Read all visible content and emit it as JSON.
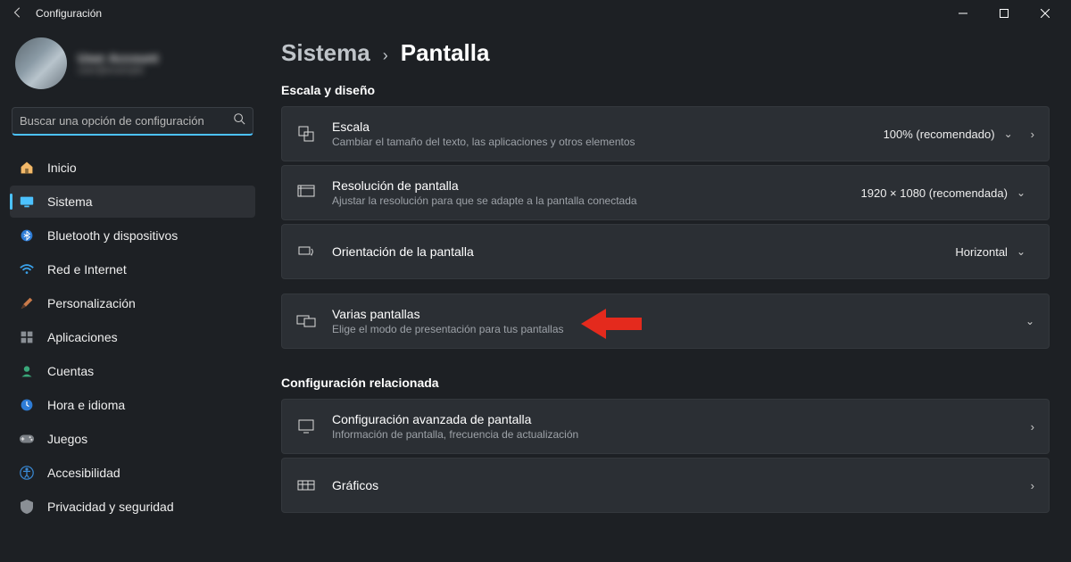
{
  "window": {
    "title": "Configuración"
  },
  "profile": {
    "name": "User Account",
    "sub": "user@example"
  },
  "search": {
    "placeholder": "Buscar una opción de configuración"
  },
  "sidebar": {
    "items": [
      {
        "label": "Inicio"
      },
      {
        "label": "Sistema"
      },
      {
        "label": "Bluetooth y dispositivos"
      },
      {
        "label": "Red e Internet"
      },
      {
        "label": "Personalización"
      },
      {
        "label": "Aplicaciones"
      },
      {
        "label": "Cuentas"
      },
      {
        "label": "Hora e idioma"
      },
      {
        "label": "Juegos"
      },
      {
        "label": "Accesibilidad"
      },
      {
        "label": "Privacidad y seguridad"
      }
    ]
  },
  "breadcrumb": {
    "parent": "Sistema",
    "current": "Pantalla"
  },
  "sections": {
    "scale_header": "Escala y diseño",
    "related_header": "Configuración relacionada"
  },
  "cards": {
    "scale": {
      "title": "Escala",
      "sub": "Cambiar el tamaño del texto, las aplicaciones y otros elementos",
      "value": "100% (recomendado)"
    },
    "resolution": {
      "title": "Resolución de pantalla",
      "sub": "Ajustar la resolución para que se adapte a la pantalla conectada",
      "value": "1920 × 1080 (recomendada)"
    },
    "orientation": {
      "title": "Orientación de la pantalla",
      "value": "Horizontal"
    },
    "multi": {
      "title": "Varias pantallas",
      "sub": "Elige el modo de presentación para tus pantallas"
    },
    "advanced": {
      "title": "Configuración avanzada de pantalla",
      "sub": "Información de pantalla, frecuencia de actualización"
    },
    "graphics": {
      "title": "Gráficos"
    }
  }
}
